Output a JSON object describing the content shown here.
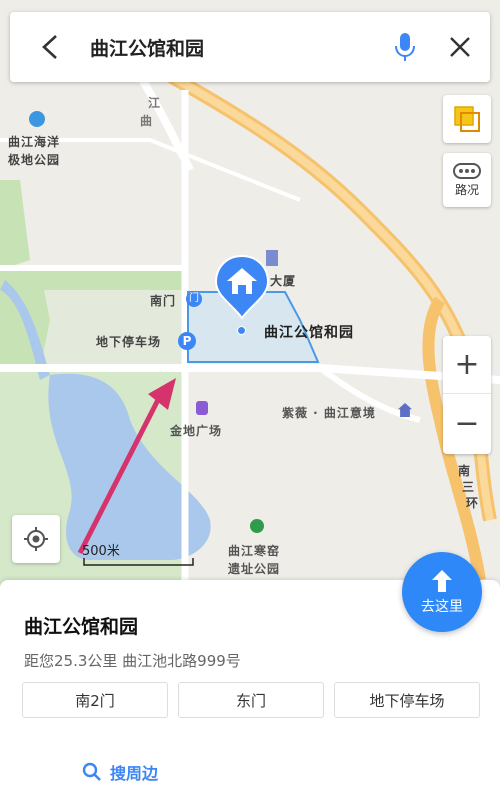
{
  "search": {
    "title": "曲江公馆和园"
  },
  "controls": {
    "traffic_label": "路况",
    "zoom_in": "+",
    "zoom_out": "−"
  },
  "map": {
    "scale_label": "500米",
    "labels": {
      "haiyang": "曲江海洋",
      "jidi": "极地公园",
      "dasha": "大厦",
      "nanmen": "南门",
      "parking": "地下停车场",
      "place": "曲江公馆和园",
      "jindi": "金地广场",
      "ziwei": "紫薇 · 曲江意境",
      "hanyao": "曲江寒窑",
      "yizhi": "遗址公园",
      "ring_a": "南",
      "ring_b": "三",
      "ring_c": "环",
      "road_a": "曲",
      "road_b": "江"
    }
  },
  "go_button": {
    "label": "去这里"
  },
  "panel": {
    "name": "曲江公馆和园",
    "address": "距您25.3公里  曲江池北路999号",
    "entries": [
      "南2门",
      "东门",
      "地下停车场"
    ],
    "nearby_label": "搜周边"
  },
  "colors": {
    "accent": "#2f88f7",
    "arrow": "#d6336c",
    "water": "#a9c8ec",
    "park": "#c7e3b6",
    "road_orange": "#f6c26b"
  }
}
